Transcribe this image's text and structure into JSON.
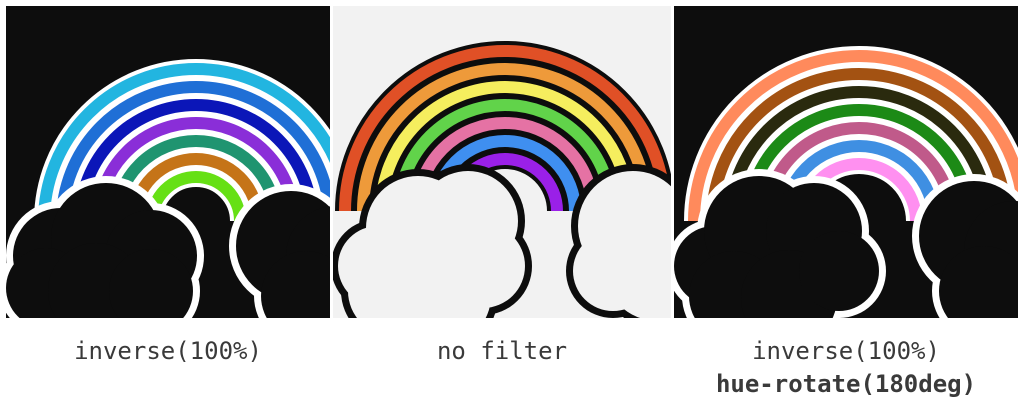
{
  "panels": [
    {
      "caption": "inverse(100%)",
      "background": "#0d0d0d",
      "outline": "#ffffff",
      "cloud_fill": "#0d0d0d",
      "bands": [
        "#22b5e0",
        "#1f6fd6",
        "#0b16b8",
        "#8a2ed8",
        "#1f9470",
        "#c57418",
        "#66e015"
      ]
    },
    {
      "caption": "no filter",
      "background": "#f2f2f2",
      "outline": "#0d0d0d",
      "cloud_fill": "#f2f2f2",
      "bands": [
        "#e05026",
        "#ee9a3a",
        "#f5ee5e",
        "#61d34a",
        "#e572a4",
        "#3f8ff0",
        "#9a20e8"
      ]
    },
    {
      "caption": "inverse(100%)",
      "caption_line2": "hue-rotate(180deg)",
      "background": "#0d0d0d",
      "outline": "#ffffff",
      "cloud_fill": "#0d0d0d",
      "bands": [
        "#ff8a5c",
        "#a35212",
        "#2a2a0e",
        "#1c8a16",
        "#c05a8a",
        "#3f8fe2",
        "#ff90f0"
      ]
    }
  ]
}
